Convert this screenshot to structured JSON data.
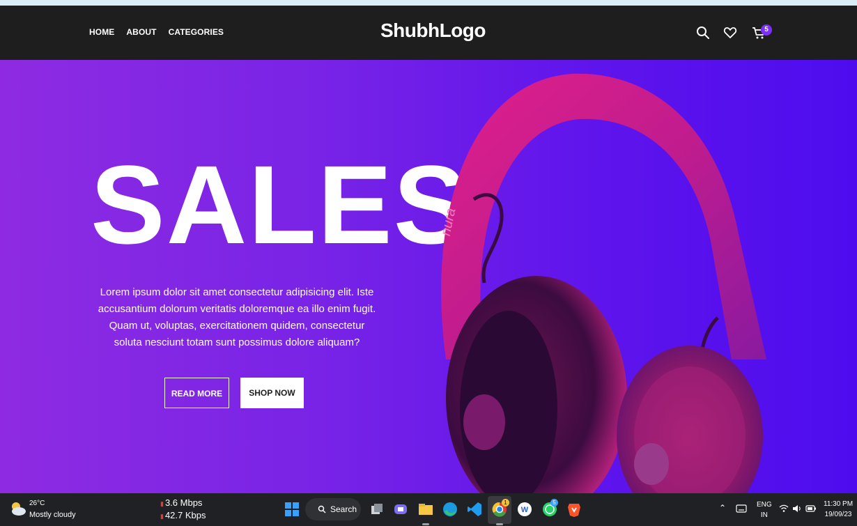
{
  "header": {
    "nav": [
      "HOME",
      "ABOUT",
      "CATEGORIES"
    ],
    "logo": "ShubhLogo",
    "cart_count": "5"
  },
  "hero": {
    "title": "SALES",
    "text": "Lorem ipsum dolor sit amet consectetur adipisicing elit. Iste accusantium dolorum veritatis doloremque ea illo enim fugit. Quam ut, voluptas, exercitationem quidem, consectetur soluta nesciunt totam sunt possimus dolore aliquam?",
    "read_more": "READ MORE",
    "shop_now": "SHOP NOW",
    "product_brand": "nura"
  },
  "taskbar": {
    "weather_temp": "26°C",
    "weather_desc": "Mostly cloudy",
    "net_up": "3.6 Mbps",
    "net_down": "42.7 Kbps",
    "search_label": "Search",
    "lang_top": "ENG",
    "lang_bottom": "IN",
    "time": "11:30 PM",
    "date": "19/09/23",
    "chrome_badge": "1",
    "whatsapp_badge": "5"
  },
  "colors": {
    "header_bg": "#1e1e1e",
    "hero_gradient_start": "#8e2be2",
    "hero_gradient_end": "#4e0cee",
    "accent": "#7b2ff7"
  }
}
